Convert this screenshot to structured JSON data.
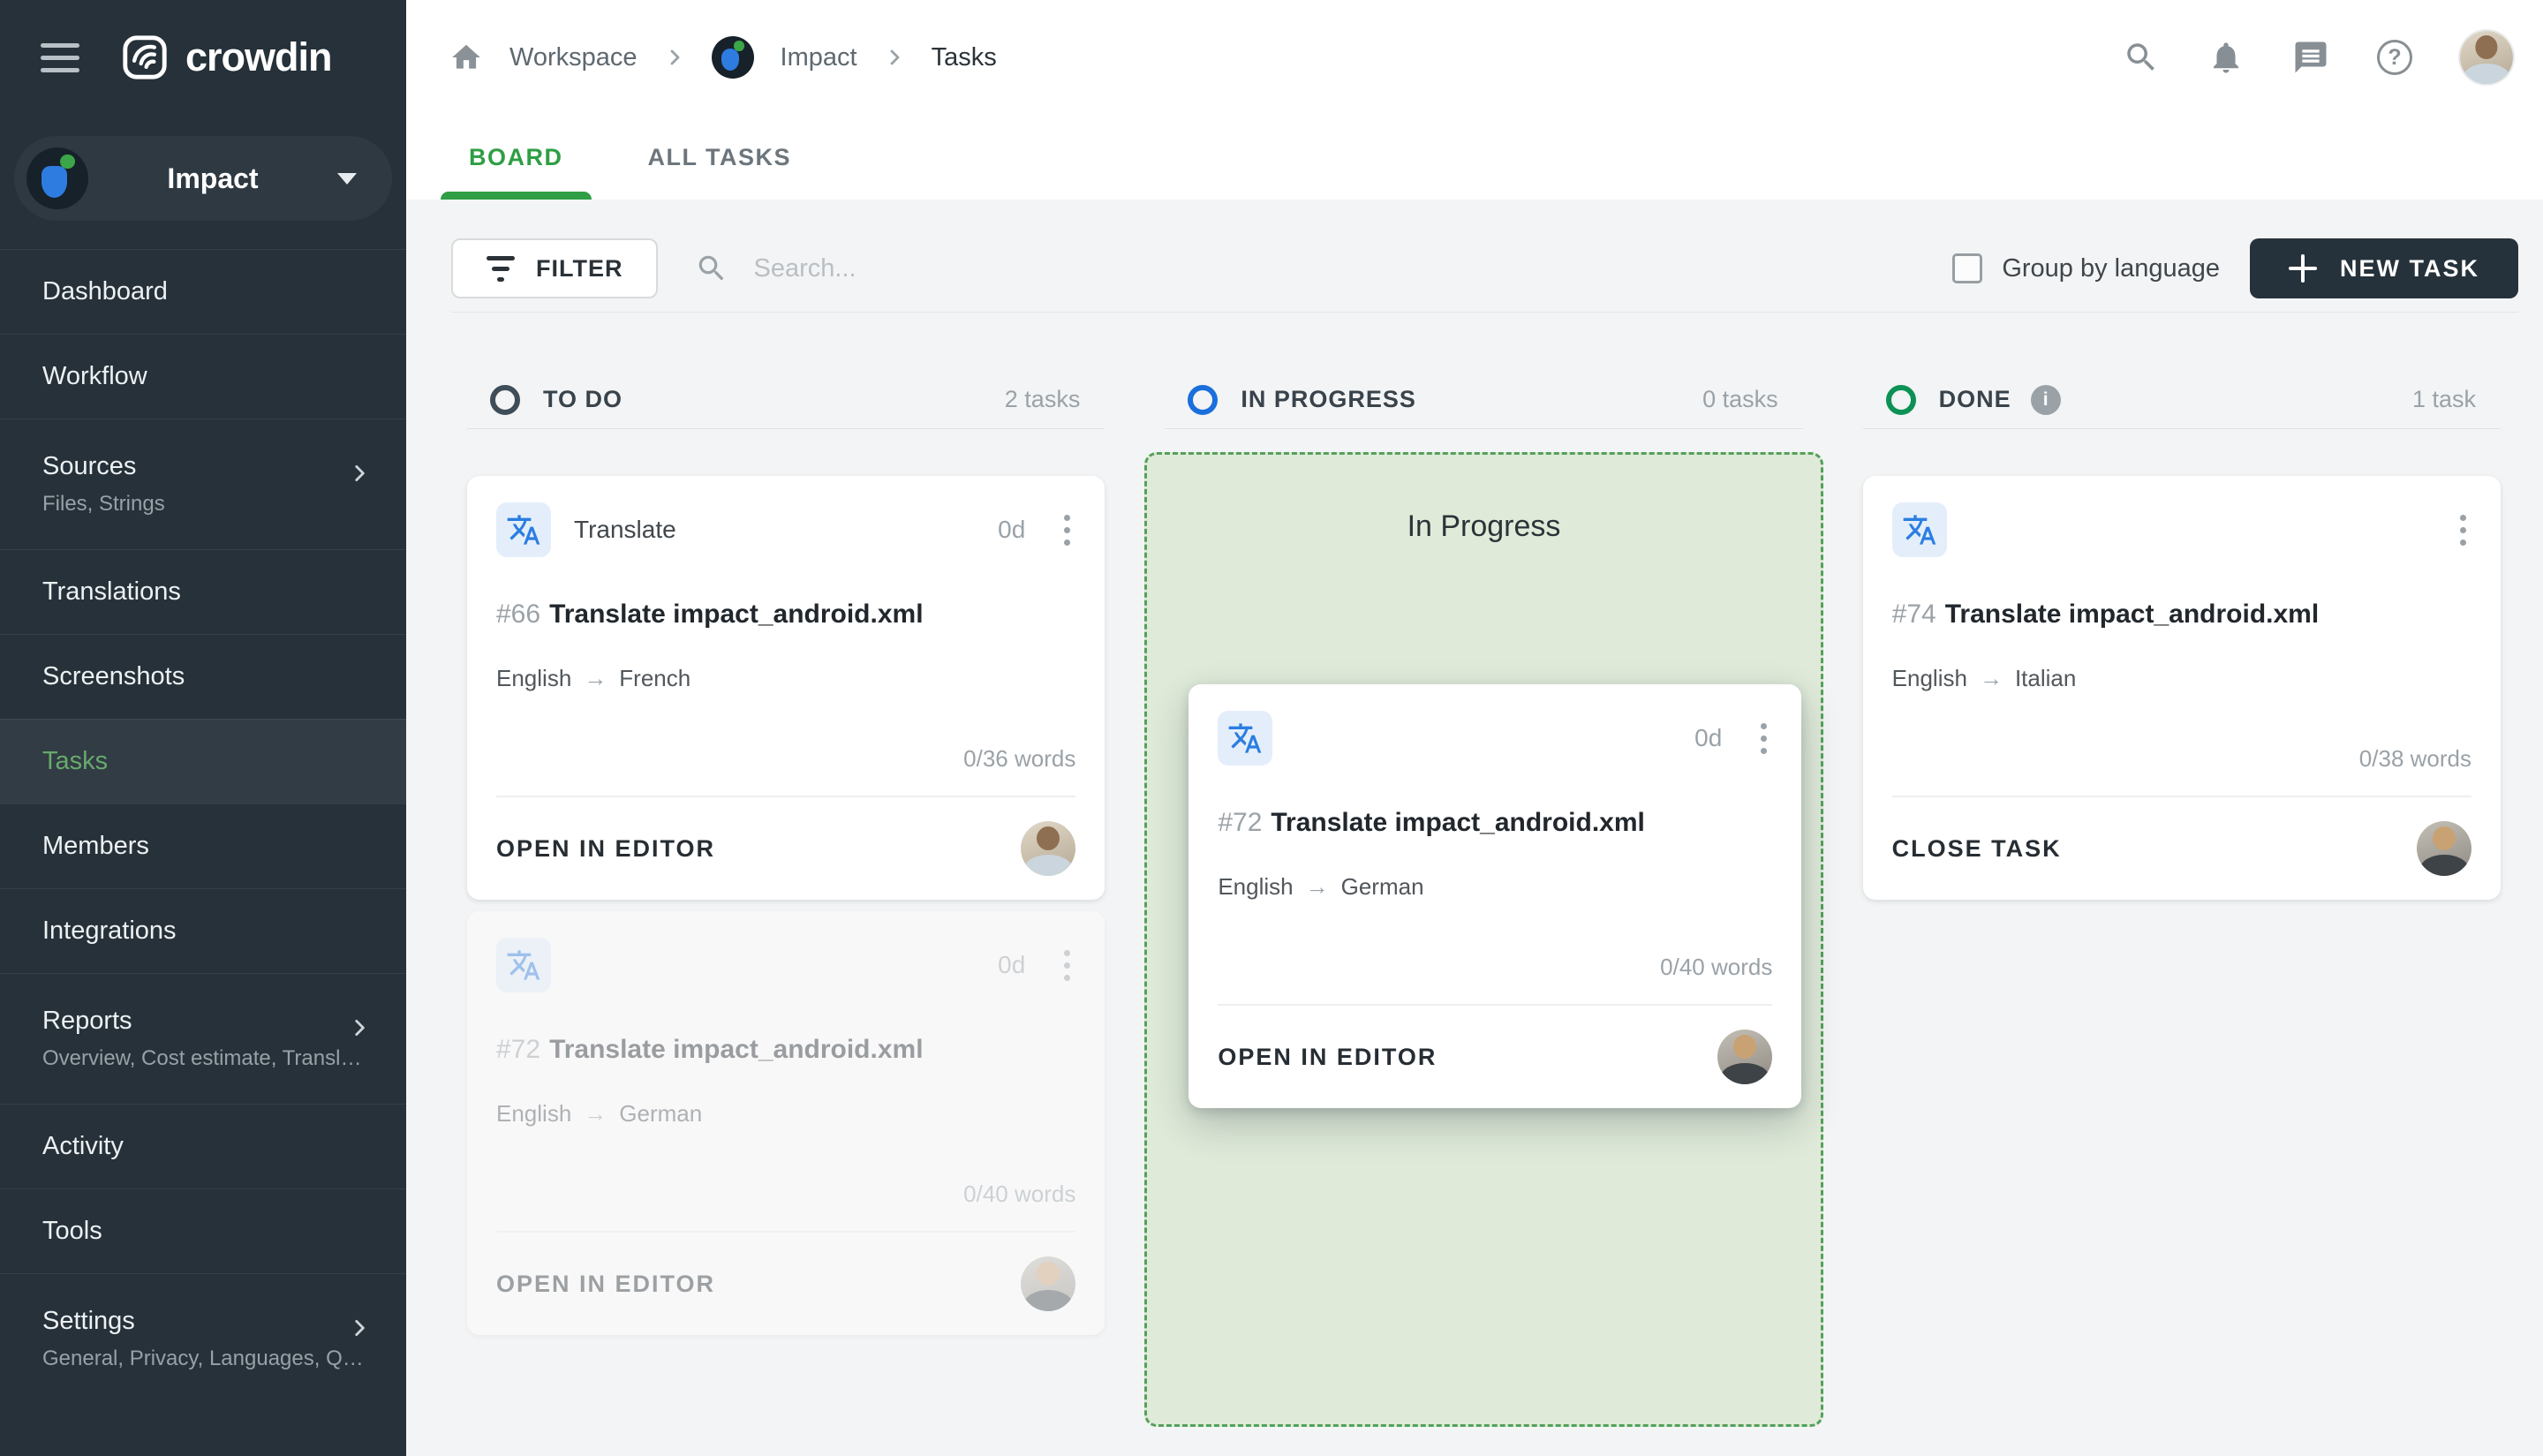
{
  "app": {
    "logo_text": "crowdin"
  },
  "sidebar": {
    "project_label": "Impact",
    "items": [
      {
        "label": "Dashboard"
      },
      {
        "label": "Workflow"
      },
      {
        "label": "Sources",
        "sublabel": "Files, Strings"
      },
      {
        "label": "Translations"
      },
      {
        "label": "Screenshots"
      },
      {
        "label": "Tasks",
        "active": true
      },
      {
        "label": "Members"
      },
      {
        "label": "Integrations"
      },
      {
        "label": "Reports",
        "sublabel": "Overview, Cost estimate, Transl…"
      },
      {
        "label": "Activity"
      },
      {
        "label": "Tools"
      },
      {
        "label": "Settings",
        "sublabel": "General, Privacy, Languages, Q…"
      }
    ]
  },
  "topbar": {
    "breadcrumb": [
      "Workspace",
      "Impact",
      "Tasks"
    ]
  },
  "tabs": [
    {
      "label": "BOARD",
      "active": true
    },
    {
      "label": "ALL TASKS",
      "active": false
    }
  ],
  "toolbar": {
    "filter_label": "FILTER",
    "search_placeholder": "Search...",
    "group_by_label": "Group by language",
    "new_task_label": "NEW TASK"
  },
  "board": {
    "arrow": "→",
    "columns": [
      {
        "name": "TO DO",
        "count": "2 tasks"
      },
      {
        "name": "IN PROGRESS",
        "count": "0 tasks",
        "dropzone_label": "In Progress"
      },
      {
        "name": "DONE",
        "count": "1 task"
      }
    ]
  },
  "cards": [
    {
      "type_label": "Translate",
      "duration": "0d",
      "id": "#66",
      "title": "Translate impact_android.xml",
      "lang_from": "English",
      "lang_to": "French",
      "words": "0/36 words",
      "action": "OPEN IN EDITOR"
    },
    {
      "duration": "0d",
      "id": "#72",
      "title": "Translate impact_android.xml",
      "lang_from": "English",
      "lang_to": "German",
      "words": "0/40 words",
      "action": "OPEN IN EDITOR"
    },
    {
      "duration": "0d",
      "id": "#72",
      "title": "Translate impact_android.xml",
      "lang_from": "English",
      "lang_to": "German",
      "words": "0/40 words",
      "action": "OPEN IN EDITOR"
    },
    {
      "id": "#74",
      "title": "Translate impact_android.xml",
      "lang_from": "English",
      "lang_to": "Italian",
      "words": "0/38 words",
      "action": "CLOSE TASK"
    }
  ],
  "icons": {
    "help_glyph": "?",
    "info_glyph": "i"
  },
  "colors": {
    "brand_green": "#2F9E44",
    "sidebar_active_green": "#69A96D",
    "todo_circle": "#3E4D57",
    "in_progress_circle": "#1A6FDC",
    "done_circle": "#0C9255",
    "accent_dark": "#26323B",
    "dropzone_bg": "#DFEAD9",
    "dropzone_border": "#54A159",
    "translate_icon_blue": "#2B7DE1"
  }
}
